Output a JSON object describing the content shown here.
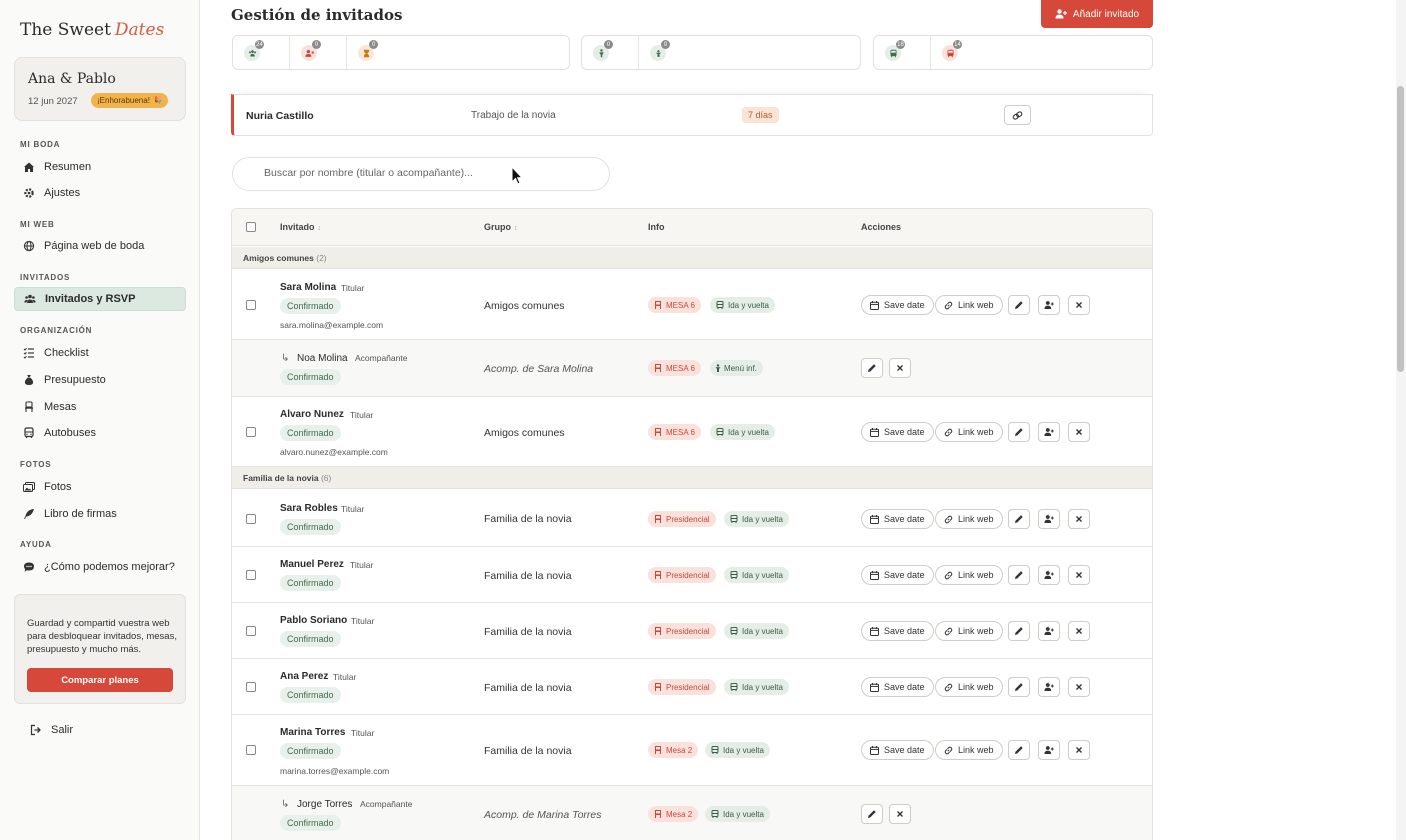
{
  "sidebar": {
    "logo_main": "The Sweet",
    "logo_accent": "Dates",
    "couple": {
      "name": "Ana & Pablo",
      "date": "12 jun 2027",
      "badge": "¡Enhorabuena! 🎉"
    },
    "sections": [
      {
        "title": "MI BODA",
        "items": [
          {
            "label": "Resumen",
            "icon": "home-icon"
          },
          {
            "label": "Ajustes",
            "icon": "gear-icon"
          }
        ]
      },
      {
        "title": "MI WEB",
        "items": [
          {
            "label": "Página web de boda",
            "icon": "globe-icon"
          }
        ]
      },
      {
        "title": "INVITADOS",
        "items": [
          {
            "label": "Invitados y RSVP",
            "icon": "users-icon",
            "active": true
          }
        ]
      },
      {
        "title": "ORGANIZACIÓN",
        "items": [
          {
            "label": "Checklist",
            "icon": "checklist-icon"
          },
          {
            "label": "Presupuesto",
            "icon": "money-bag-icon"
          },
          {
            "label": "Mesas",
            "icon": "chair-icon"
          },
          {
            "label": "Autobuses",
            "icon": "bus-icon"
          }
        ]
      },
      {
        "title": "FOTOS",
        "items": [
          {
            "label": "Fotos",
            "icon": "photos-icon"
          },
          {
            "label": "Libro de firmas",
            "icon": "feather-icon"
          }
        ]
      },
      {
        "title": "AYUDA",
        "items": [
          {
            "label": "¿Cómo podemos mejorar?",
            "icon": "comment-icon"
          }
        ]
      }
    ],
    "promo_text": "Guardad y compartid vuestra web para desbloquear invitados, mesas, presupuesto y mucho más.",
    "promo_button": "Comparar planes",
    "logout": "Salir"
  },
  "header": {
    "title": "Gestión de invitados",
    "add_button": "Añadir invitado"
  },
  "stats": [
    {
      "icon": "users-icon",
      "count": "24",
      "color": "#3d6d4c",
      "bg": "#e4ede6"
    },
    {
      "icon": "user-x-icon",
      "count": "0",
      "color": "#c44a37",
      "bg": "#fbe1dc"
    },
    {
      "icon": "hourglass-icon",
      "count": "0",
      "color": "#c87a1a",
      "bg": "#fbe7d3"
    },
    {
      "icon": "adult-icon",
      "count": "0",
      "color": "#3d6d4c",
      "bg": "#e4ede6"
    },
    {
      "icon": "child-icon",
      "count": "0",
      "color": "#3d6d4c",
      "bg": "#e4ede6"
    },
    {
      "icon": "bus-icon",
      "count": "18",
      "color": "#3d6d4c",
      "bg": "#e4ede6"
    },
    {
      "icon": "bus-icon",
      "count": "14",
      "color": "#c44a37",
      "bg": "#fbe1dc"
    }
  ],
  "pending": {
    "name": "Nuria Castillo",
    "group": "Trabajo de la novia",
    "days": "7 días"
  },
  "search": {
    "placeholder": "Buscar por nombre (titular o acompañante)..."
  },
  "table": {
    "headers": {
      "guest": "Invitado",
      "group": "Grupo",
      "info": "Info",
      "actions": "Acciones"
    },
    "sort_glyph": "↕",
    "status_label": "Confirmado",
    "action_labels": {
      "save_date": "Save date",
      "link_web": "Link web"
    },
    "groups": [
      {
        "name": "Amigos comunes",
        "count": "(2)"
      },
      {
        "name": "Familia de la novia",
        "count": "(6)"
      }
    ],
    "rows": [
      {
        "name": "Sara Molina",
        "role": "Titular",
        "email": "sara.molina@example.com",
        "group": "Amigos comunes",
        "table": "MESA 6",
        "transport": "Ida y vuelta"
      },
      {
        "name": "Noa Molina",
        "role": "Acompañante",
        "group": "Acomp. de Sara Molina",
        "table": "MESA 6",
        "transport": "Menú inf."
      },
      {
        "name": "Alvaro Nunez",
        "role": "Titular",
        "email": "alvaro.nunez@example.com",
        "group": "Amigos comunes",
        "table": "MESA 6",
        "transport": "Ida y vuelta"
      },
      {
        "name": "Sara Robles",
        "role": "Titular",
        "group": "Familia de la novia",
        "table": "Presidencial",
        "transport": "Ida y vuelta"
      },
      {
        "name": "Manuel Perez",
        "role": "Titular",
        "group": "Familia de la novia",
        "table": "Presidencial",
        "transport": "Ida y vuelta"
      },
      {
        "name": "Pablo Soriano",
        "role": "Titular",
        "group": "Familia de la novia",
        "table": "Presidencial",
        "transport": "Ida y vuelta"
      },
      {
        "name": "Ana Perez",
        "role": "Titular",
        "group": "Familia de la novia",
        "table": "Presidencial",
        "transport": "Ida y vuelta"
      },
      {
        "name": "Marina Torres",
        "role": "Titular",
        "email": "marina.torres@example.com",
        "group": "Familia de la novia",
        "table": "Mesa 2",
        "transport": "Ida y vuelta"
      },
      {
        "name": "Jorge Torres",
        "role": "Acompañante",
        "group": "Acomp. de Marina Torres",
        "table": "Mesa 2",
        "transport": "Ida y vuelta"
      }
    ]
  }
}
